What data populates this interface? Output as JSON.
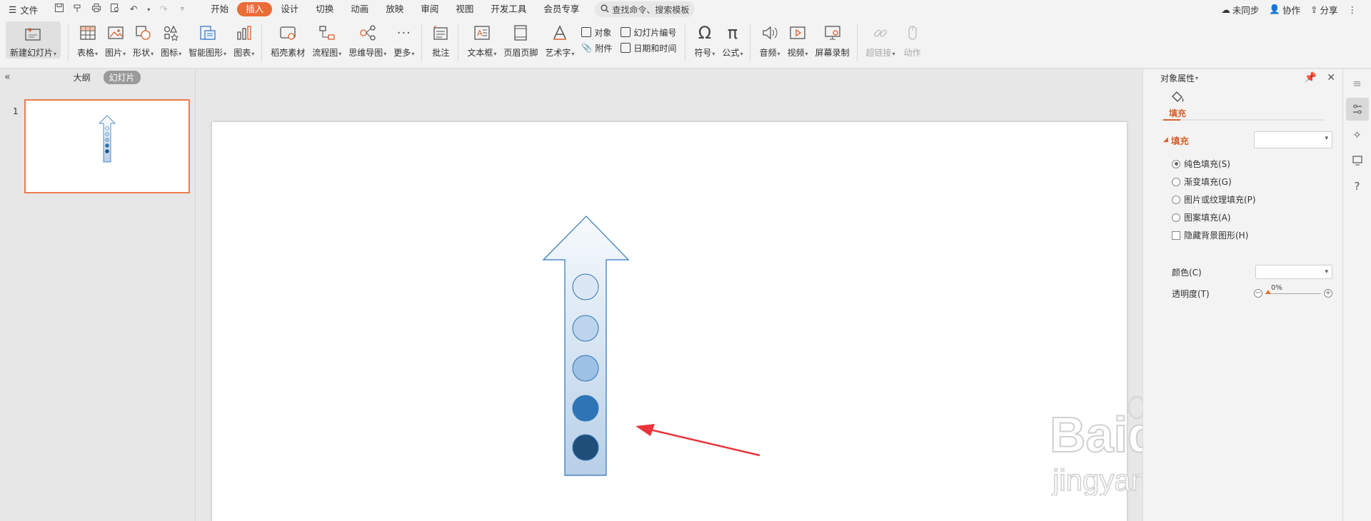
{
  "menubar": {
    "file_label": "文件",
    "tabs": [
      "开始",
      "插入",
      "设计",
      "切换",
      "动画",
      "放映",
      "审阅",
      "视图",
      "开发工具",
      "会员专享"
    ],
    "active_tab": "插入",
    "search_placeholder": "查找命令、搜索模板",
    "right": {
      "sync": "未同步",
      "collab": "协作",
      "share": "分享"
    }
  },
  "ribbon": {
    "new_slide": "新建幻灯片",
    "table": "表格",
    "picture": "图片",
    "shape": "形状",
    "icon": "图标",
    "smartart": "智能图形",
    "chart": "图表",
    "docer": "稻壳素材",
    "flowchart": "流程图",
    "mindmap": "思维导图",
    "more": "更多",
    "comment": "批注",
    "textbox": "文本框",
    "header_footer": "页眉页脚",
    "wordart": "艺术字",
    "object": "对象",
    "attachment": "附件",
    "slide_number": "幻灯片编号",
    "date_time": "日期和时间",
    "symbol": "符号",
    "formula": "公式",
    "audio": "音频",
    "video": "视频",
    "screen_record": "屏幕录制",
    "hyperlink": "超链接",
    "action": "动作"
  },
  "left_panel": {
    "tab_outline": "大纲",
    "tab_slides": "幻灯片",
    "slide_number": "1"
  },
  "property_pane": {
    "title": "对象属性",
    "tab_fill": "填充",
    "section_fill": "填充",
    "options": [
      "纯色填充(S)",
      "渐变填充(G)",
      "图片或纹理填充(P)",
      "图案填充(A)"
    ],
    "selected_option": "纯色填充(S)",
    "hide_bg": "隐藏背景图形(H)",
    "color_label": "颜色(C)",
    "transparency_label": "透明度(T)",
    "transparency_value": "0%"
  },
  "slide": {
    "circle_colors": [
      "#dbe7f4",
      "#bcd4ec",
      "#9dc1e5",
      "#2e75b6",
      "#1f4e79"
    ],
    "arrow_annotation_color": "#e8343a"
  },
  "watermark": {
    "brand": "Baidu经验",
    "url": "jingyan.baidu.com"
  },
  "colors": {
    "accent_orange": "#ea6c36",
    "arrow_stroke": "#2e75b6"
  }
}
